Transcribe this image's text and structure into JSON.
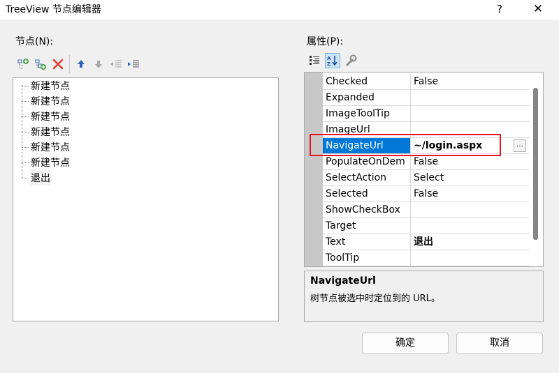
{
  "window": {
    "title": "TreeView 节点编辑器",
    "help": "?",
    "close": "✕"
  },
  "nodes_panel": {
    "label": "节点(N):",
    "toolbar": [
      "add-root-icon",
      "add-child-icon",
      "delete-icon",
      "move-up-icon",
      "move-down-icon",
      "outdent-icon",
      "indent-icon"
    ],
    "items": [
      "新建节点",
      "新建节点",
      "新建节点",
      "新建节点",
      "新建节点",
      "新建节点",
      "退出"
    ],
    "selected_index": 6
  },
  "props_panel": {
    "label": "属性(P):",
    "toolbar": [
      "categorized-icon",
      "alphabetical-icon",
      "property-pages-icon"
    ],
    "rows": [
      {
        "name": "Checked",
        "value": "False"
      },
      {
        "name": "Expanded",
        "value": ""
      },
      {
        "name": "ImageToolTip",
        "value": ""
      },
      {
        "name": "ImageUrl",
        "value": ""
      },
      {
        "name": "NavigateUrl",
        "value": "~/login.aspx"
      },
      {
        "name": "PopulateOnDem",
        "value": "False"
      },
      {
        "name": "SelectAction",
        "value": "Select"
      },
      {
        "name": "Selected",
        "value": "False"
      },
      {
        "name": "ShowCheckBox",
        "value": ""
      },
      {
        "name": "Target",
        "value": ""
      },
      {
        "name": "Text",
        "value": "退出"
      },
      {
        "name": "ToolTip",
        "value": ""
      }
    ],
    "selected_row": 4,
    "ellipsis": "...",
    "description": {
      "title": "NavigateUrl",
      "text": "树节点被选中时定位到的 URL。"
    }
  },
  "buttons": {
    "ok": "确定",
    "cancel": "取消"
  },
  "colors": {
    "selection": "#0078d7",
    "highlight": "#e81123",
    "gutter": "#c8c8c8"
  }
}
